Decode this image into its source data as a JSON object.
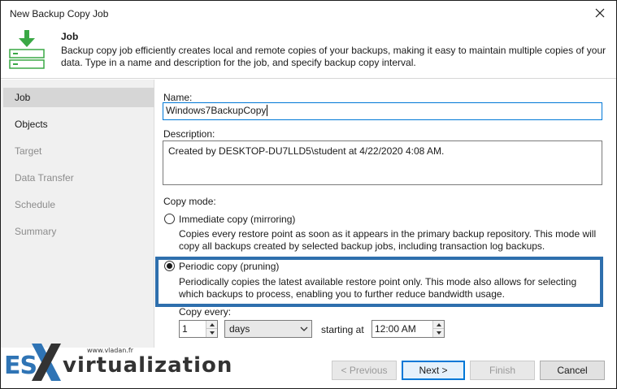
{
  "window": {
    "title": "New Backup Copy Job"
  },
  "header": {
    "title": "Job",
    "description": "Backup copy job efficiently creates local and remote copies of your backups, making it easy to maintain multiple copies of your data. Type in a name and description for the job, and specify backup copy interval."
  },
  "sidebar": {
    "items": [
      {
        "label": "Job",
        "state": "active"
      },
      {
        "label": "Objects",
        "state": "enabled"
      },
      {
        "label": "Target",
        "state": "disabled"
      },
      {
        "label": "Data Transfer",
        "state": "disabled"
      },
      {
        "label": "Schedule",
        "state": "disabled"
      },
      {
        "label": "Summary",
        "state": "disabled"
      }
    ]
  },
  "form": {
    "name_label": "Name:",
    "name_value": "Windows7BackupCopy",
    "description_label": "Description:",
    "description_value": "Created by DESKTOP-DU7LLD5\\student at 4/22/2020 4:08 AM.",
    "copy_mode_label": "Copy mode:",
    "immediate": {
      "label": "Immediate copy (mirroring)",
      "checked": false,
      "description": "Copies every restore point as soon as it appears in the primary backup repository. This mode will copy all backups created by selected backup jobs, including transaction log backups."
    },
    "periodic": {
      "label": "Periodic copy (pruning)",
      "checked": true,
      "description": "Periodically copies the latest available restore point only. This mode also allows for selecting which backups to process, enabling you to further reduce bandwidth usage."
    },
    "copy_every_label": "Copy every:",
    "copy_every_value": "1",
    "unit_value": "days",
    "starting_at_label": "starting at",
    "starting_at_value": "12:00 AM"
  },
  "buttons": {
    "previous": "< Previous",
    "next": "Next >",
    "finish": "Finish",
    "cancel": "Cancel"
  },
  "watermark": {
    "brand_left": "ES",
    "brand_right": "virtualization",
    "small": "www.vladan.fr"
  },
  "colors": {
    "highlight_border": "#2e6fad",
    "icon_green": "#3aa845",
    "primary_button_border": "#0078d7",
    "brand_blue": "#2f74b5"
  }
}
